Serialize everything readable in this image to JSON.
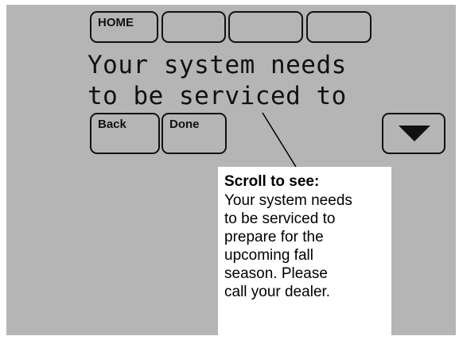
{
  "softkeys": {
    "home_label": "HOME",
    "blank_1_label": "",
    "blank_2_label": "",
    "blank_3_label": ""
  },
  "display": {
    "line_1": "Your system needs",
    "line_2": "to be serviced to"
  },
  "nav": {
    "back_label": "Back",
    "done_label": "Done"
  },
  "callout": {
    "title": "Scroll to see:",
    "lines": [
      "Your system needs",
      "to be serviced to",
      "prepare for the",
      "upcoming fall",
      "season. Please",
      "call your dealer."
    ]
  },
  "colors": {
    "screen_background": "#b5b5b5",
    "outline": "#111111",
    "callout_background": "#ffffff"
  },
  "icons": {
    "scroll_down": "triangle-down-icon"
  }
}
